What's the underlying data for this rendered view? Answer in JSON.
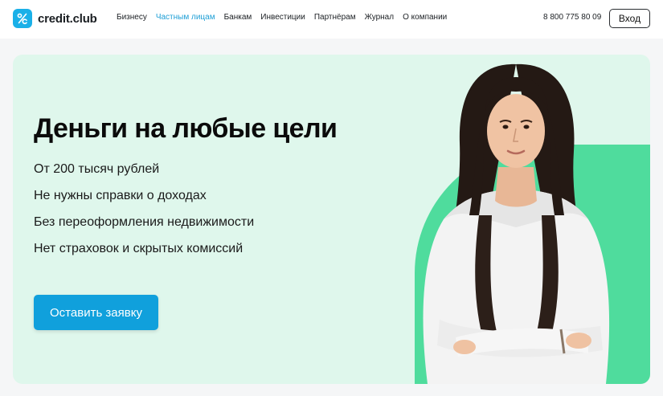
{
  "header": {
    "logo_text": "credit.club",
    "nav": [
      {
        "label": "Бизнесу",
        "active": false
      },
      {
        "label": "Частным лицам",
        "active": true
      },
      {
        "label": "Банкам",
        "active": false
      },
      {
        "label": "Инвестиции",
        "active": false
      },
      {
        "label": "Партнёрам",
        "active": false
      },
      {
        "label": "Журнал",
        "active": false
      },
      {
        "label": "О компании",
        "active": false
      }
    ],
    "phone": "8 800 775 80 09",
    "login_label": "Вход"
  },
  "hero": {
    "title": "Деньги на любые цели",
    "features": [
      "От 200 тысяч рублей",
      "Не нужны справки о доходах",
      "Без переоформления недвижимости",
      "Нет страховок и скрытых комиссий"
    ],
    "cta_label": "Оставить заявку"
  },
  "colors": {
    "brand": "#1ab0e8",
    "nav_active": "#1f9fd6",
    "hero_bg": "#dff7ec",
    "hero_accent": "#4fdc9d",
    "cta_bg": "#10a0dc"
  },
  "icons": {
    "logo": "percent-logo-icon"
  }
}
